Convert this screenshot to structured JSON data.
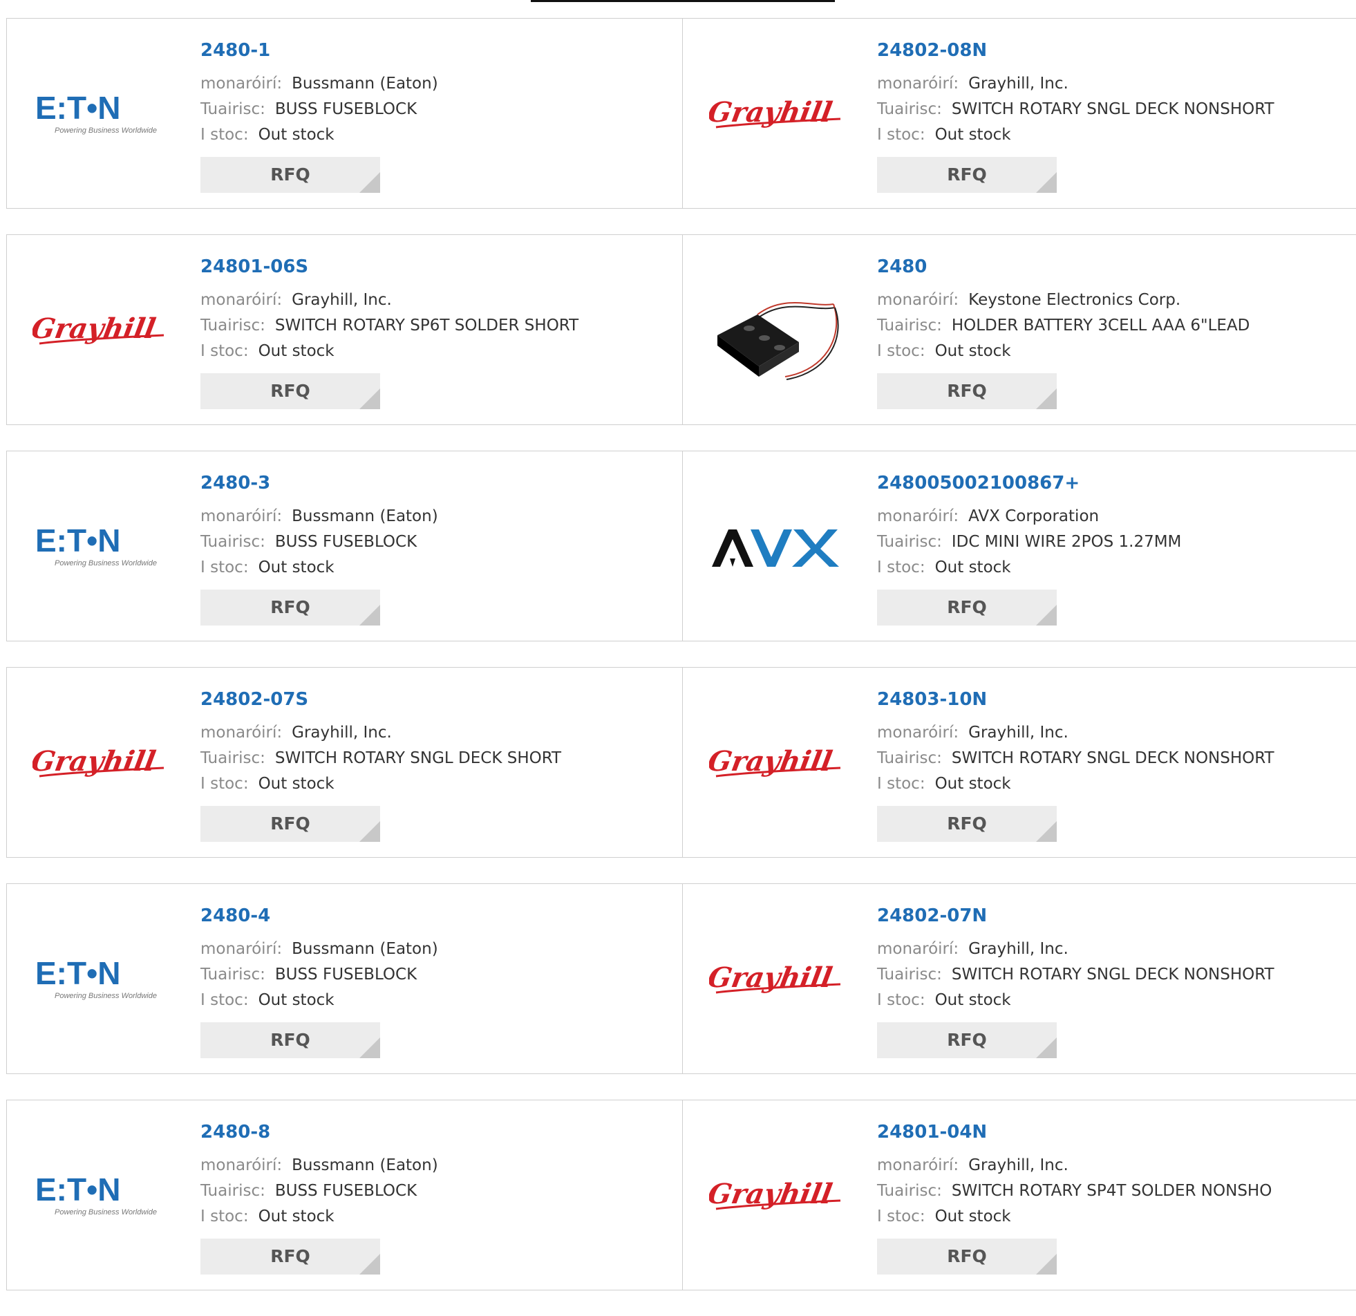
{
  "labels": {
    "manufacturer": "monaróirí:",
    "description": "Tuairisc:",
    "stock": "I stoc:",
    "rfq": "RFQ"
  },
  "logos": {
    "eaton_text": "E:T•N",
    "eaton_tagline": "Powering Business Worldwide",
    "grayhill_text": "Grayhill",
    "avx_text": "AVX"
  },
  "products": [
    {
      "pn": "2480-1",
      "manufacturer": "Bussmann (Eaton)",
      "description": "BUSS FUSEBLOCK",
      "stock": "Out stock",
      "logo": "eaton"
    },
    {
      "pn": "24802-08N",
      "manufacturer": "Grayhill, Inc.",
      "description": "SWITCH ROTARY SNGL DECK NONSHORT",
      "stock": "Out stock",
      "logo": "grayhill"
    },
    {
      "pn": "24801-06S",
      "manufacturer": "Grayhill, Inc.",
      "description": "SWITCH ROTARY SP6T SOLDER SHORT",
      "stock": "Out stock",
      "logo": "grayhill"
    },
    {
      "pn": "2480",
      "manufacturer": "Keystone Electronics Corp.",
      "description": "HOLDER BATTERY 3CELL AAA 6\"LEAD",
      "stock": "Out stock",
      "logo": "battery"
    },
    {
      "pn": "2480-3",
      "manufacturer": "Bussmann (Eaton)",
      "description": "BUSS FUSEBLOCK",
      "stock": "Out stock",
      "logo": "eaton"
    },
    {
      "pn": "248005002100867+",
      "manufacturer": "AVX Corporation",
      "description": "IDC MINI WIRE 2POS 1.27MM",
      "stock": "Out stock",
      "logo": "avx"
    },
    {
      "pn": "24802-07S",
      "manufacturer": "Grayhill, Inc.",
      "description": "SWITCH ROTARY SNGL DECK SHORT",
      "stock": "Out stock",
      "logo": "grayhill"
    },
    {
      "pn": "24803-10N",
      "manufacturer": "Grayhill, Inc.",
      "description": "SWITCH ROTARY SNGL DECK NONSHORT",
      "stock": "Out stock",
      "logo": "grayhill"
    },
    {
      "pn": "2480-4",
      "manufacturer": "Bussmann (Eaton)",
      "description": "BUSS FUSEBLOCK",
      "stock": "Out stock",
      "logo": "eaton"
    },
    {
      "pn": "24802-07N",
      "manufacturer": "Grayhill, Inc.",
      "description": "SWITCH ROTARY SNGL DECK NONSHORT",
      "stock": "Out stock",
      "logo": "grayhill"
    },
    {
      "pn": "2480-8",
      "manufacturer": "Bussmann (Eaton)",
      "description": "BUSS FUSEBLOCK",
      "stock": "Out stock",
      "logo": "eaton"
    },
    {
      "pn": "24801-04N",
      "manufacturer": "Grayhill, Inc.",
      "description": "SWITCH ROTARY SP4T SOLDER NONSHO",
      "stock": "Out stock",
      "logo": "grayhill"
    }
  ],
  "colors": {
    "link": "#1f6db5",
    "eaton_blue": "#1f6db5",
    "grayhill_red": "#d42027",
    "avx_blue": "#1f7dc1"
  }
}
